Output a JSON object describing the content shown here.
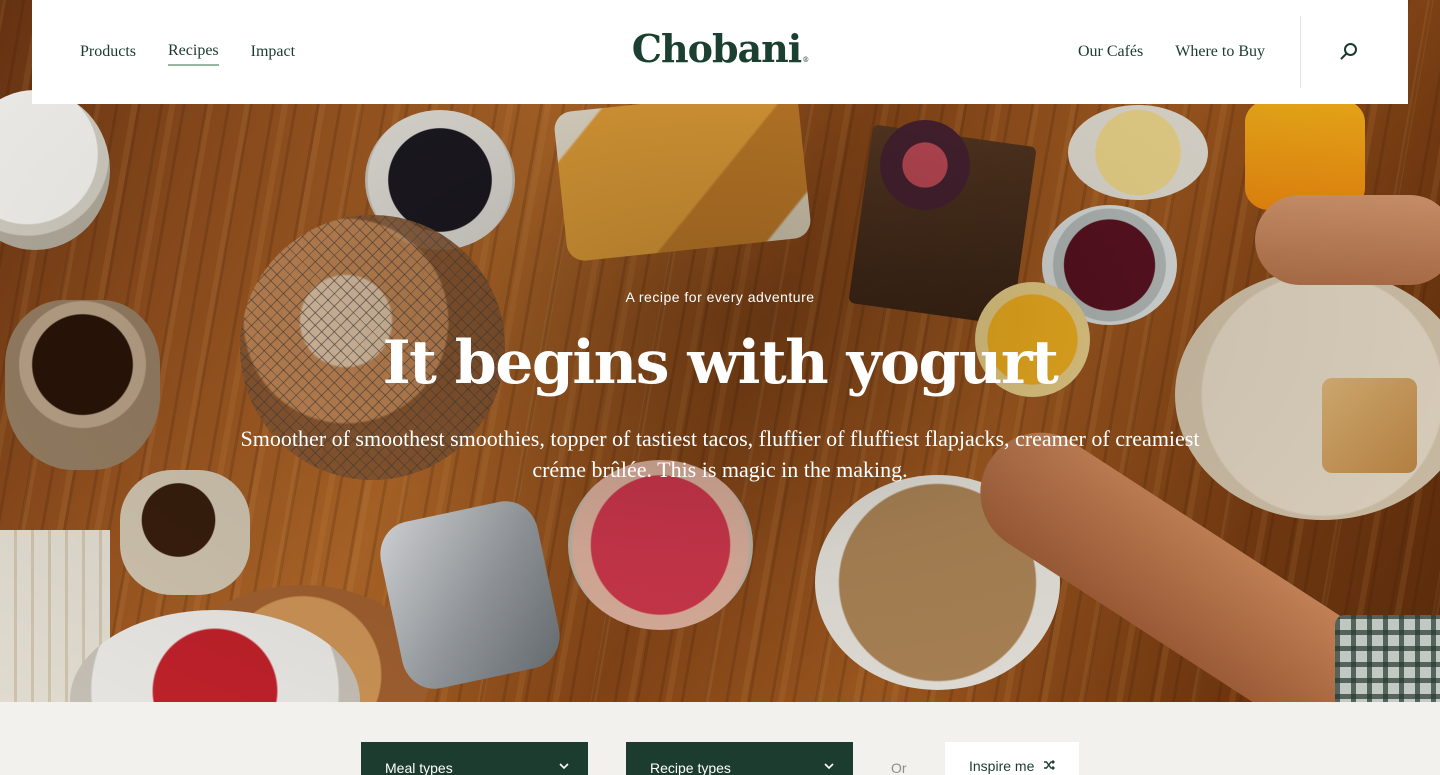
{
  "header": {
    "nav_left": [
      {
        "label": "Products"
      },
      {
        "label": "Recipes"
      },
      {
        "label": "Impact"
      }
    ],
    "logo": "Chobani",
    "nav_right": [
      {
        "label": "Our Cafés"
      },
      {
        "label": "Where to Buy"
      }
    ],
    "search_icon": "search-icon",
    "active_nav": "Recipes"
  },
  "hero": {
    "eyebrow": "A recipe for every adventure",
    "headline": "It begins with yogurt",
    "subhead": "Smoother of smoothest smoothies, topper of tastiest tacos, fluffier of fluffiest flapjacks, creamer of creamiest créme brûlée. This is magic in the making."
  },
  "filters": {
    "meal_types_label": "Meal types",
    "recipe_types_label": "Recipe types",
    "or_label": "Or",
    "inspire_label": "Inspire me",
    "chevron_icon": "chevron-down-icon",
    "shuffle_icon": "shuffle-icon"
  },
  "colors": {
    "brand_green": "#1d3c30",
    "logo_green": "#1b4032",
    "active_underline": "#98b59f",
    "background": "#f2f1ed"
  }
}
